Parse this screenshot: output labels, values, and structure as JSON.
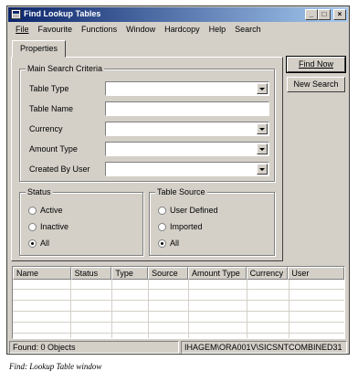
{
  "window": {
    "title": "Find Lookup Tables",
    "minimize": "_",
    "maximize": "□",
    "close": "×"
  },
  "menu": [
    "File",
    "Favourite",
    "Functions",
    "Window",
    "Hardcopy",
    "Help",
    "Search"
  ],
  "tabs": {
    "properties": "Properties"
  },
  "main_search": {
    "legend": "Main Search Criteria",
    "table_type_label": "Table Type",
    "table_name_label": "Table Name",
    "currency_label": "Currency",
    "amount_type_label": "Amount Type",
    "created_by_label": "Created By User",
    "table_type_value": "",
    "table_name_value": "",
    "currency_value": "",
    "amount_type_value": "",
    "created_by_value": ""
  },
  "status_group": {
    "legend": "Status",
    "options": [
      "Active",
      "Inactive",
      "All"
    ],
    "selected": "All"
  },
  "source_group": {
    "legend": "Table Source",
    "options": [
      "User Defined",
      "Imported",
      "All"
    ],
    "selected": "All"
  },
  "buttons": {
    "find_now": "Find Now",
    "new_search": "New Search"
  },
  "results": {
    "columns": [
      "Name",
      "Status",
      "Type",
      "Source",
      "Amount Type",
      "Currency",
      "User"
    ],
    "rows": []
  },
  "statusbar": {
    "found": "Found: 0 Objects",
    "connection": "IHAGEM\\ORA001V\\SICSNTCOMBINED31"
  },
  "caption": "Find: Lookup Table window"
}
